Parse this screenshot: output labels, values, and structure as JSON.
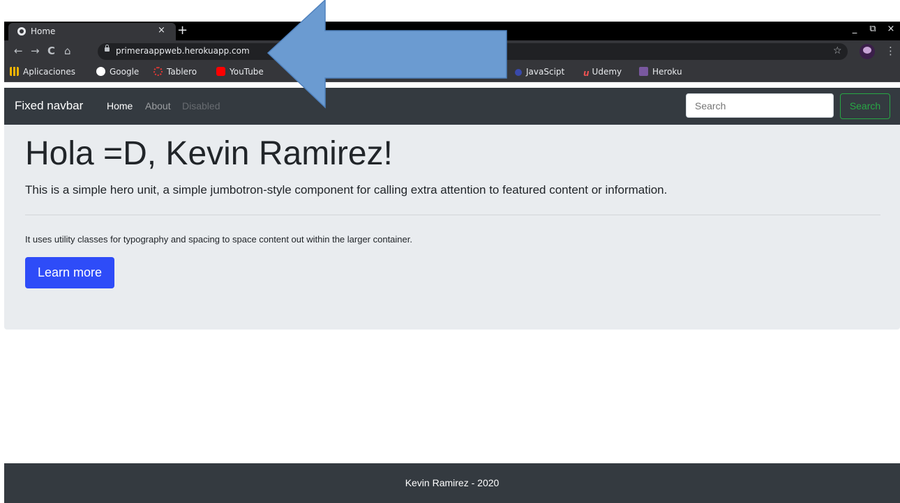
{
  "browser": {
    "tab": {
      "title": "Home",
      "close": "×"
    },
    "new_tab": "+",
    "window_controls": {
      "minimize": "_",
      "restore": "⧉",
      "close": "×"
    },
    "nav": {
      "back": "←",
      "forward": "→",
      "reload": "C",
      "home": "⌂"
    },
    "url": "primeraappweb.herokuapp.com",
    "star": "☆",
    "menu": "⋮",
    "bookmarks": [
      {
        "label": "Aplicaciones",
        "icon": "apps-grid-icon",
        "color": "#f4b400"
      },
      {
        "label": "Google",
        "icon": "google-icon",
        "color": "#ffffff"
      },
      {
        "label": "Tablero",
        "icon": "tablero-icon",
        "color": "#e53935"
      },
      {
        "label": "YouTube",
        "icon": "youtube-icon",
        "color": "#ff0000"
      },
      {
        "label": "JavaScipt",
        "icon": "javascript-icon",
        "color": "#3949ab"
      },
      {
        "label": "Udemy",
        "icon": "udemy-icon",
        "color": "#ec5252"
      },
      {
        "label": "Heroku",
        "icon": "heroku-icon",
        "color": "#79589f"
      }
    ]
  },
  "navbar": {
    "brand": "Fixed navbar",
    "links": [
      {
        "label": "Home",
        "state": "active"
      },
      {
        "label": "About",
        "state": "normal"
      },
      {
        "label": "Disabled",
        "state": "disabled"
      }
    ],
    "search_placeholder": "Search",
    "search_button": "Search"
  },
  "jumbotron": {
    "title": "Hola =D, Kevin Ramirez!",
    "lead": "This is a simple hero unit, a simple jumbotron-style component for calling extra attention to featured content or information.",
    "text": "It uses utility classes for typography and spacing to space content out within the larger container.",
    "button": "Learn more"
  },
  "footer": {
    "text": "Kevin Ramirez - 2020"
  },
  "colors": {
    "navbar_bg": "#343a40",
    "jumbotron_bg": "#e9ecef",
    "primary_button": "#2e4cf8",
    "success_outline": "#28a745",
    "annotation_arrow": "#6b9bd1"
  }
}
